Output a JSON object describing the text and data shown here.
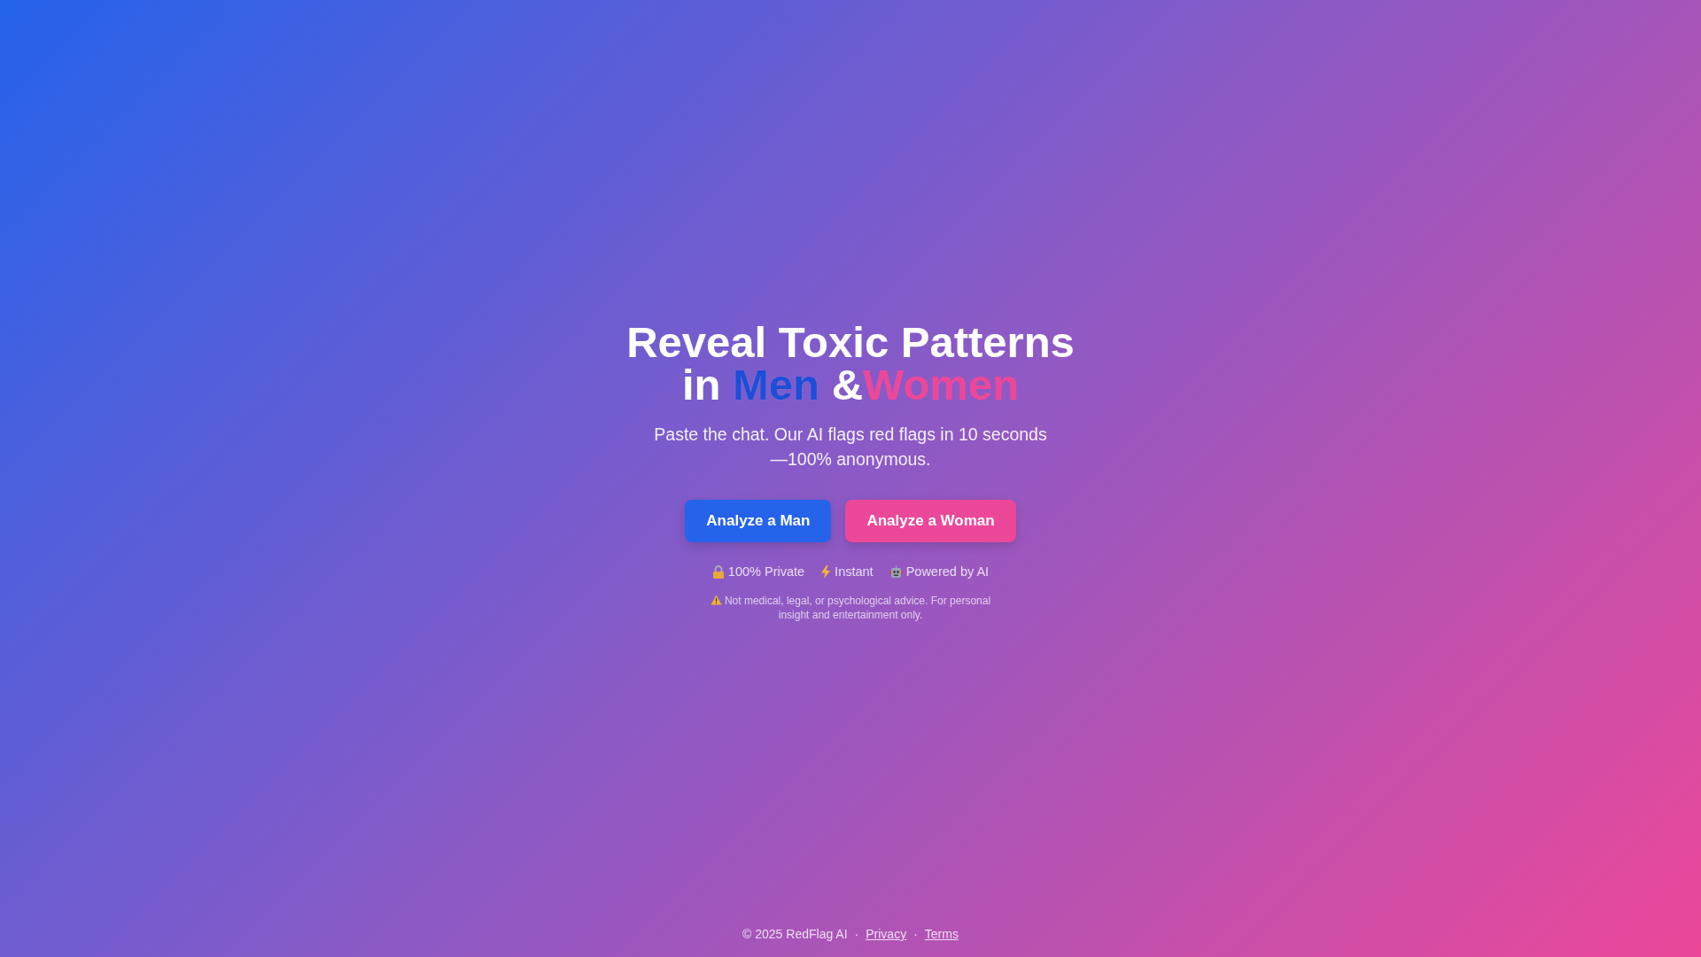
{
  "heading": {
    "line1": "Reveal Toxic Patterns",
    "prefix": "in",
    "men": "Men",
    "amp": "&",
    "women": "Women"
  },
  "subtitle": "Paste the chat. Our AI flags red flags in 10 seconds—100% anonymous.",
  "buttons": [
    {
      "label": "Analyze a Man",
      "kind": "men"
    },
    {
      "label": "Analyze a Woman",
      "kind": "women"
    }
  ],
  "features": [
    {
      "label": "100% Private"
    },
    {
      "label": "Instant"
    },
    {
      "label": "Powered by AI"
    }
  ],
  "disclaimer": "Not medical, legal, or psychological advice. For personal insight and entertainment only.",
  "footer": {
    "copyright": "© 2025 RedFlag AI",
    "separator": "·",
    "links": [
      "Privacy",
      "Terms"
    ]
  }
}
